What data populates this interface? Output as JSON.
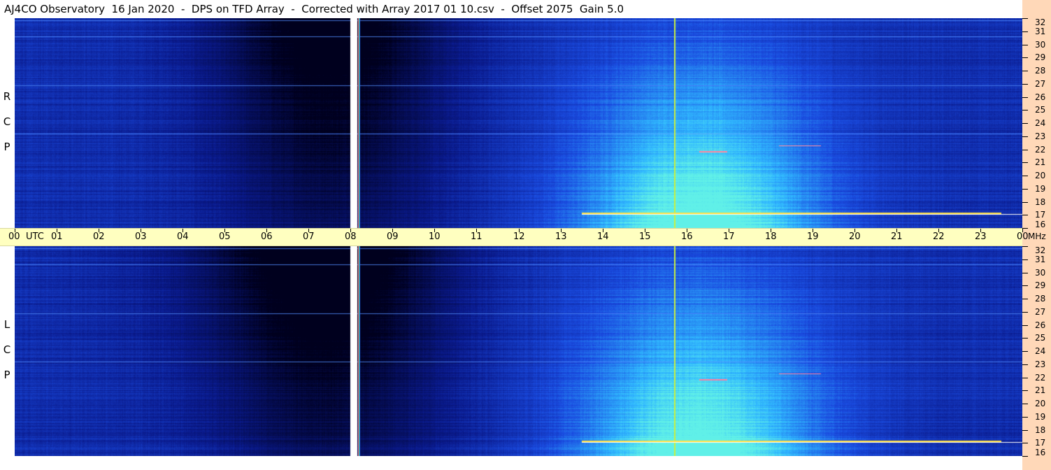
{
  "title": "AJ4CO Observatory  16 Jan 2020  -  DPS on TFD Array  -  Corrected with Array 2017 01 10.csv  -  Offset 2075  Gain 5.0",
  "chart_data": {
    "type": "heatmap",
    "title": "AJ4CO Observatory  16 Jan 2020  -  DPS on TFD Array  -  Corrected with Array 2017 01 10.csv  -  Offset 2075  Gain 5.0",
    "panels": [
      {
        "name": "RCP",
        "label_letters": [
          "R",
          "C",
          "P"
        ]
      },
      {
        "name": "LCP",
        "label_letters": [
          "L",
          "C",
          "P"
        ]
      }
    ],
    "x_axis": {
      "unit": "UTC",
      "tick_labels": [
        "00",
        "01",
        "02",
        "03",
        "04",
        "05",
        "06",
        "07",
        "08",
        "09",
        "10",
        "11",
        "12",
        "13",
        "14",
        "15",
        "16",
        "17",
        "18",
        "19",
        "20",
        "21",
        "22",
        "23",
        "00"
      ],
      "range_hours": [
        0,
        24
      ]
    },
    "y_axis": {
      "unit": "MHz",
      "tick_labels": [
        "16",
        "17",
        "18",
        "19",
        "20",
        "21",
        "22",
        "23",
        "24",
        "25",
        "26",
        "27",
        "28",
        "29",
        "30",
        "31",
        "32"
      ],
      "range_mhz": [
        16,
        32
      ]
    },
    "colors": {
      "night": "#00001e",
      "background": "#0a1a8c",
      "mid": "#1a4be0",
      "day": "#30b8ff",
      "peak": "#60f0e8",
      "hot_line": "#ffe040",
      "axis_bar": "#ffffc0",
      "freq_strip": "#ffd8b8"
    }
  }
}
